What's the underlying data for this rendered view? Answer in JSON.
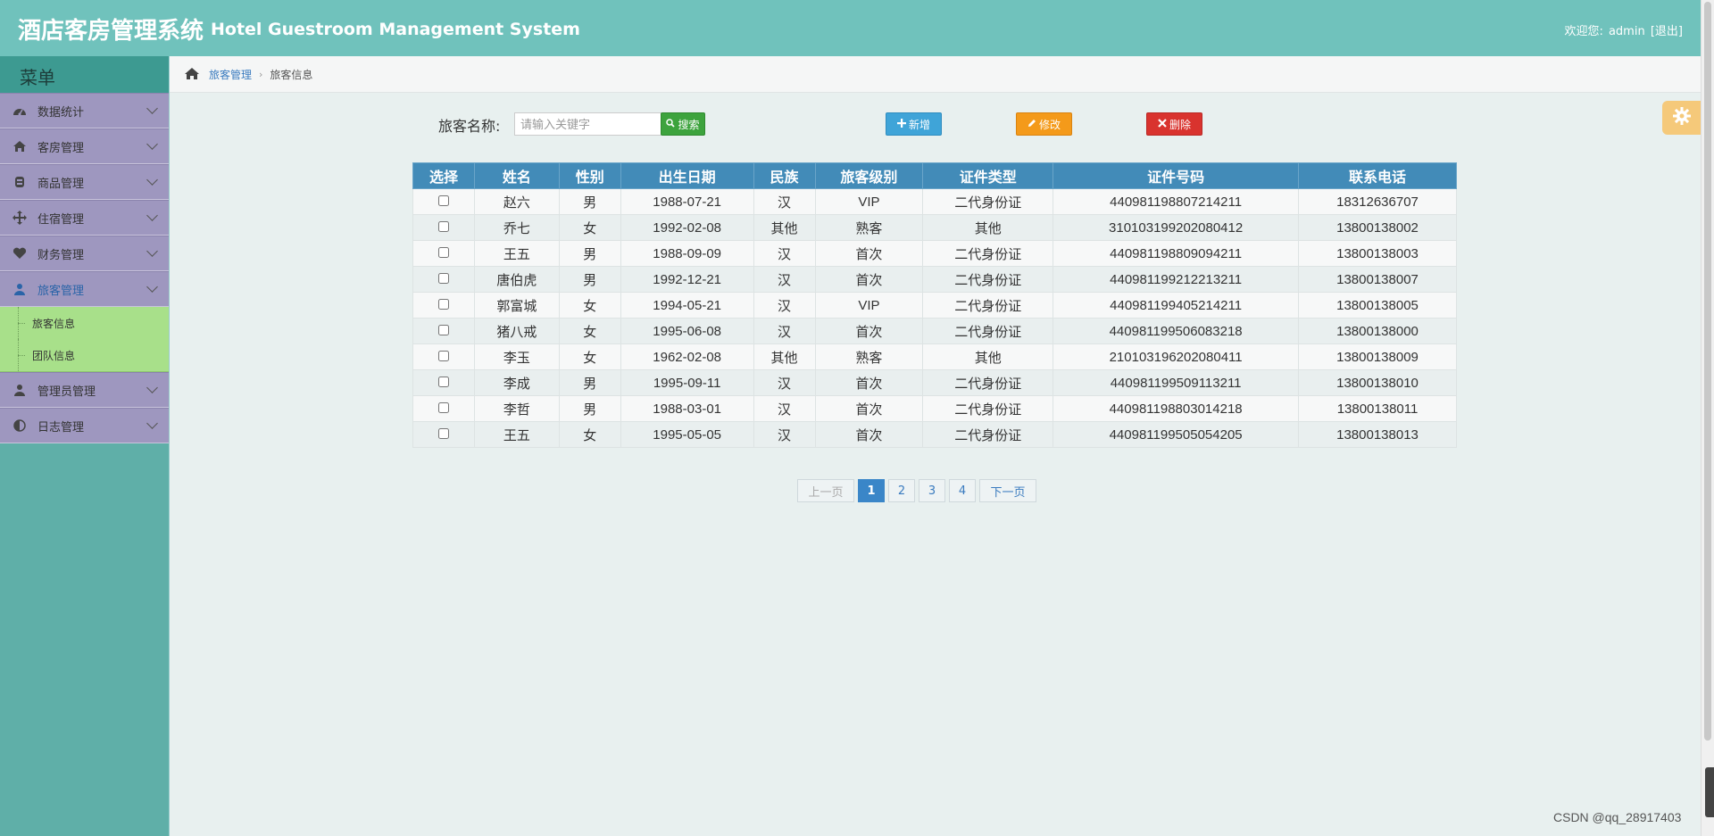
{
  "header": {
    "title_cn": "酒店客房管理系统",
    "title_en": "Hotel Guestroom Management System",
    "welcome": "欢迎您:",
    "username": "admin",
    "logout": "[退出]"
  },
  "sidebar": {
    "menu_title": "菜单",
    "items": [
      {
        "label": "数据统计",
        "icon": "dashboard-icon"
      },
      {
        "label": "客房管理",
        "icon": "home-icon"
      },
      {
        "label": "商品管理",
        "icon": "goods-icon"
      },
      {
        "label": "住宿管理",
        "icon": "arrows-icon"
      },
      {
        "label": "财务管理",
        "icon": "heart-icon"
      },
      {
        "label": "旅客管理",
        "icon": "user-icon"
      },
      {
        "label": "管理员管理",
        "icon": "user-icon"
      },
      {
        "label": "日志管理",
        "icon": "half-circle-icon"
      }
    ],
    "sub_items": [
      "旅客信息",
      "团队信息"
    ]
  },
  "breadcrumb": {
    "parent": "旅客管理",
    "current": "旅客信息"
  },
  "search": {
    "label": "旅客名称:",
    "placeholder": "请输入关键字",
    "button": "搜索"
  },
  "actions": {
    "add": "新增",
    "edit": "修改",
    "delete": "删除"
  },
  "table": {
    "headers": [
      "选择",
      "姓名",
      "性别",
      "出生日期",
      "民族",
      "旅客级别",
      "证件类型",
      "证件号码",
      "联系电话"
    ],
    "rows": [
      [
        "赵六",
        "男",
        "1988-07-21",
        "汉",
        "VIP",
        "二代身份证",
        "440981198807214211",
        "18312636707"
      ],
      [
        "乔七",
        "女",
        "1992-02-08",
        "其他",
        "熟客",
        "其他",
        "310103199202080412",
        "13800138002"
      ],
      [
        "王五",
        "男",
        "1988-09-09",
        "汉",
        "首次",
        "二代身份证",
        "440981198809094211",
        "13800138003"
      ],
      [
        "唐伯虎",
        "男",
        "1992-12-21",
        "汉",
        "首次",
        "二代身份证",
        "440981199212213211",
        "13800138007"
      ],
      [
        "郭富城",
        "女",
        "1994-05-21",
        "汉",
        "VIP",
        "二代身份证",
        "440981199405214211",
        "13800138005"
      ],
      [
        "猪八戒",
        "女",
        "1995-06-08",
        "汉",
        "首次",
        "二代身份证",
        "440981199506083218",
        "13800138000"
      ],
      [
        "李玉",
        "女",
        "1962-02-08",
        "其他",
        "熟客",
        "其他",
        "210103196202080411",
        "13800138009"
      ],
      [
        "李成",
        "男",
        "1995-09-11",
        "汉",
        "首次",
        "二代身份证",
        "440981199509113211",
        "13800138010"
      ],
      [
        "李哲",
        "男",
        "1988-03-01",
        "汉",
        "首次",
        "二代身份证",
        "440981198803014218",
        "13800138011"
      ],
      [
        "王五",
        "女",
        "1995-05-05",
        "汉",
        "首次",
        "二代身份证",
        "440981199505054205",
        "13800138013"
      ]
    ]
  },
  "pagination": {
    "prev": "上一页",
    "pages": [
      "1",
      "2",
      "3",
      "4"
    ],
    "current": "1",
    "next": "下一页"
  },
  "watermark": "CSDN @qq_28917403",
  "colors": {
    "header": "#70c2bc",
    "sidebar_item": "#9e97bf",
    "submenu": "#a8e08a",
    "table_header": "#428bb8",
    "btn_search": "#3da33d",
    "btn_add": "#3fa4d8",
    "btn_edit": "#f49a1a",
    "btn_delete": "#d9332e"
  }
}
